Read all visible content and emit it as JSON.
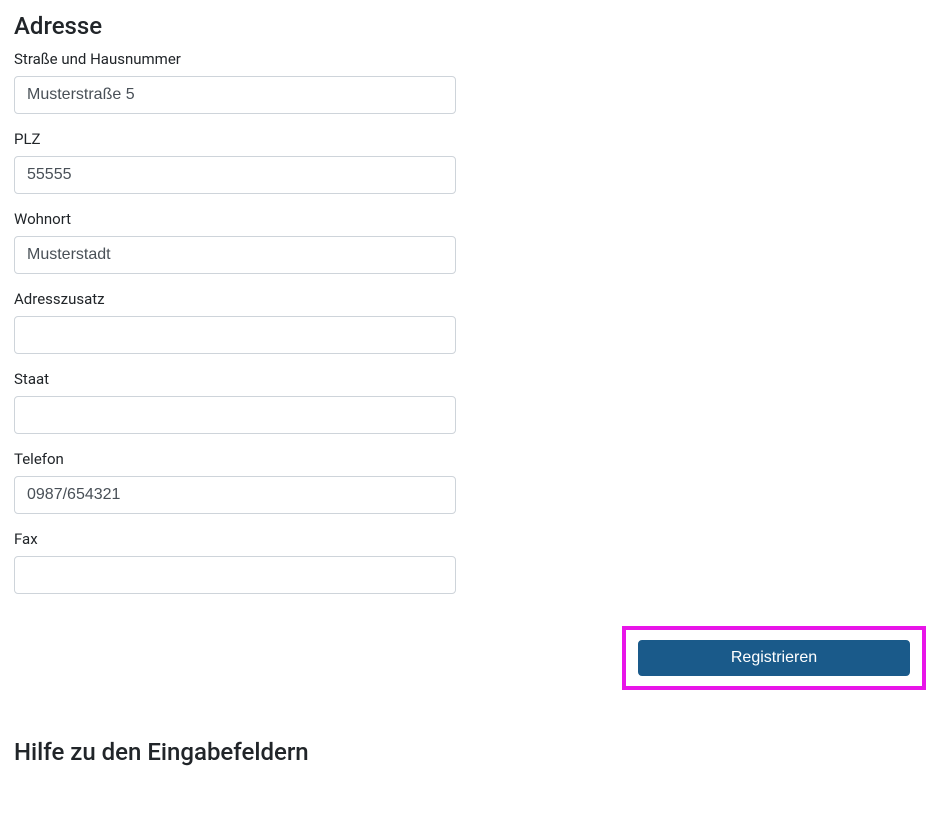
{
  "address": {
    "section_title": "Adresse",
    "street": {
      "label": "Straße und Hausnummer",
      "value": "Musterstraße 5"
    },
    "zip": {
      "label": "PLZ",
      "value": "55555"
    },
    "city": {
      "label": "Wohnort",
      "value": "Musterstadt"
    },
    "addition": {
      "label": "Adresszusatz",
      "value": ""
    },
    "state": {
      "label": "Staat",
      "value": ""
    },
    "phone": {
      "label": "Telefon",
      "value": "0987/654321"
    },
    "fax": {
      "label": "Fax",
      "value": ""
    }
  },
  "actions": {
    "register_label": "Registrieren"
  },
  "help": {
    "title": "Hilfe zu den Eingabefeldern"
  }
}
